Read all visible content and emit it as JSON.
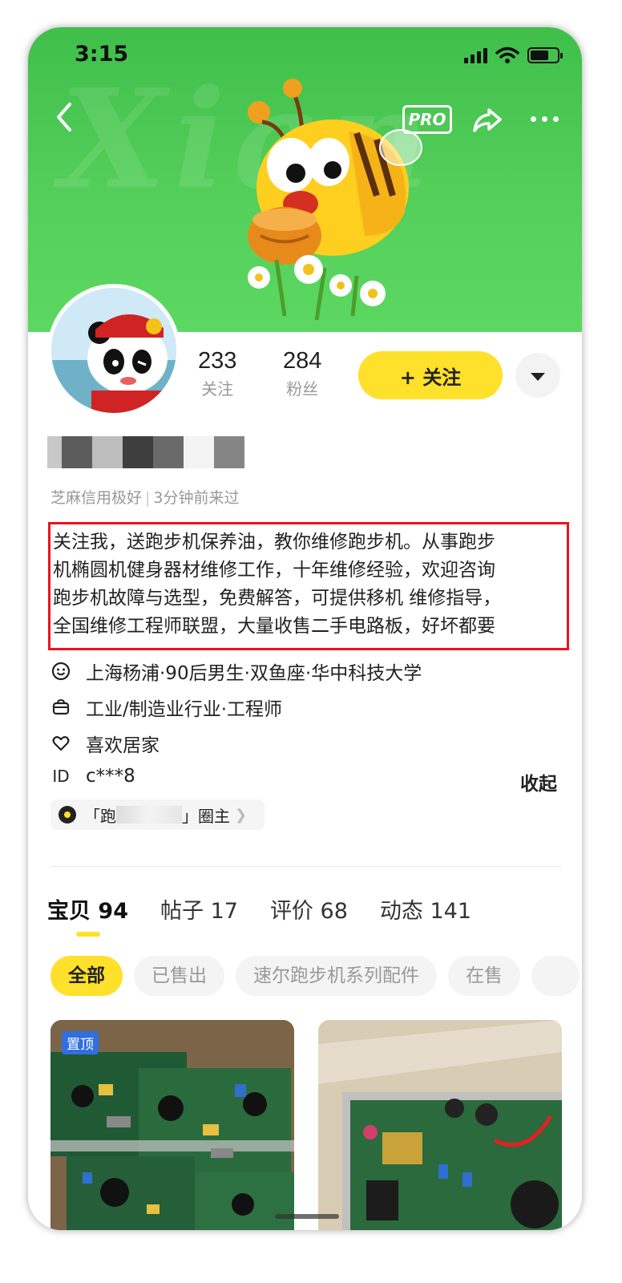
{
  "status_bar": {
    "time": "3:15"
  },
  "header": {
    "pro_label": "PRO"
  },
  "stats": [
    {
      "value": "233",
      "label": "关注"
    },
    {
      "value": "284",
      "label": "粉丝"
    }
  ],
  "follow_button": "+ 关注",
  "credit": {
    "text": "芝麻信用极好",
    "last_seen": "3分钟前来过"
  },
  "bio_lines": [
    "关注我，送跑步机保养油，教你维修跑步机。从事跑步",
    "机椭圆机健身器材维修工作，十年维修经验，欢迎咨询",
    "跑步机故障与选型，免费解答，可提供移机 维修指导，",
    "全国维修工程师联盟，大量收售二手电路板，好坏都要"
  ],
  "info": {
    "profile": "上海杨浦·90后男生·双鱼座·华中科技大学",
    "industry": "工业/制造业行业·工程师",
    "hobby": "喜欢居家",
    "id_label": "ID",
    "id_value": "c***8",
    "collapse": "收起"
  },
  "circle_tag": {
    "prefix": "「跑",
    "suffix": "」圈主"
  },
  "tabs": [
    {
      "label": "宝贝",
      "count": "94"
    },
    {
      "label": "帖子",
      "count": "17"
    },
    {
      "label": "评价",
      "count": "68"
    },
    {
      "label": "动态",
      "count": "141"
    }
  ],
  "chips": [
    "全部",
    "已售出",
    "速尔跑步机系列配件",
    "在售"
  ],
  "products": [
    {
      "badge": "置顶"
    },
    {
      "badge": ""
    }
  ],
  "colors": {
    "accent": "#ffe02a",
    "banner": "#4fca55",
    "highlight_border": "#e8141f"
  }
}
